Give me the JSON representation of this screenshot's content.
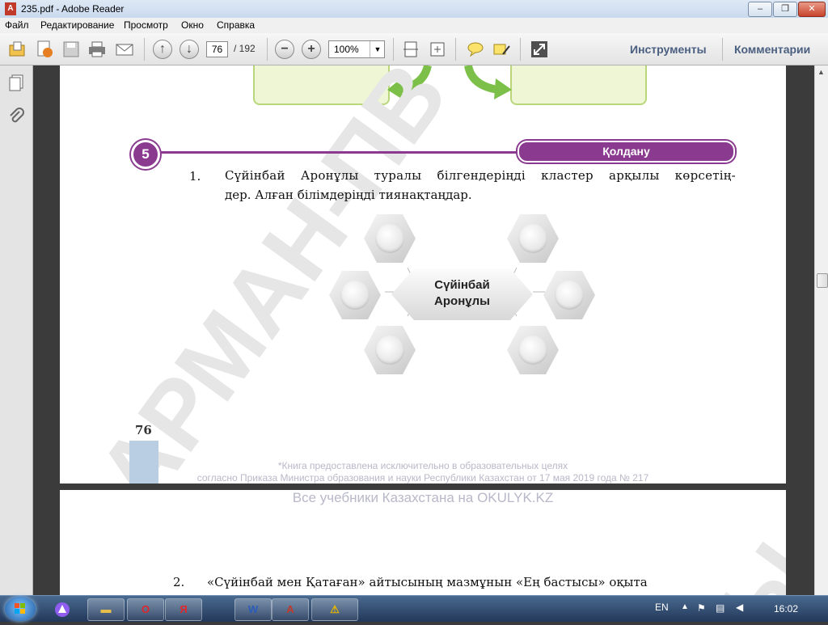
{
  "window": {
    "title": "235.pdf - Adobe Reader",
    "min": "‒",
    "max": "❐",
    "close": "✕"
  },
  "menu": [
    "Файл",
    "Редактирование",
    "Просмотр",
    "Окно",
    "Справка"
  ],
  "toolbar": {
    "page_current": "76",
    "page_total": "/ 192",
    "zoom": "100%",
    "tools_label": "Инструменты",
    "comments_label": "Комментарии"
  },
  "page1": {
    "section_number": "5",
    "section_label": "Қолдану",
    "task1_num": "1.",
    "task1_line1": "Сүйінбай Аронұлы туралы білгендеріңді кластер арқылы көрсетің-",
    "task1_line2": "дер. Алған білімдеріңді тиянақтаңдар.",
    "center_line1": "Сүйінбай",
    "center_line2": "Аронұлы",
    "page_number": "76",
    "watermark": "АРМАН-ПВ",
    "footer1": "*Книга предоставлена исключительно в образовательных целях",
    "footer2": "согласно Приказа Министра образования и науки Республики Казахстан от 17 мая 2019 года № 217"
  },
  "banner": "Все учебники Казахстана на OKULYK.KZ",
  "page2": {
    "task2_num": "2.",
    "task2_text": "«Сүйінбай мен Қатаған» айтысының мазмұнын «Ең бастысы» оқыта",
    "watermark": "Ы"
  },
  "taskbar": {
    "lang": "EN",
    "time": "16:02"
  },
  "colors": {
    "accent": "#8a3b8f",
    "arrow": "#7cc04a",
    "box": "#eef6d6"
  }
}
